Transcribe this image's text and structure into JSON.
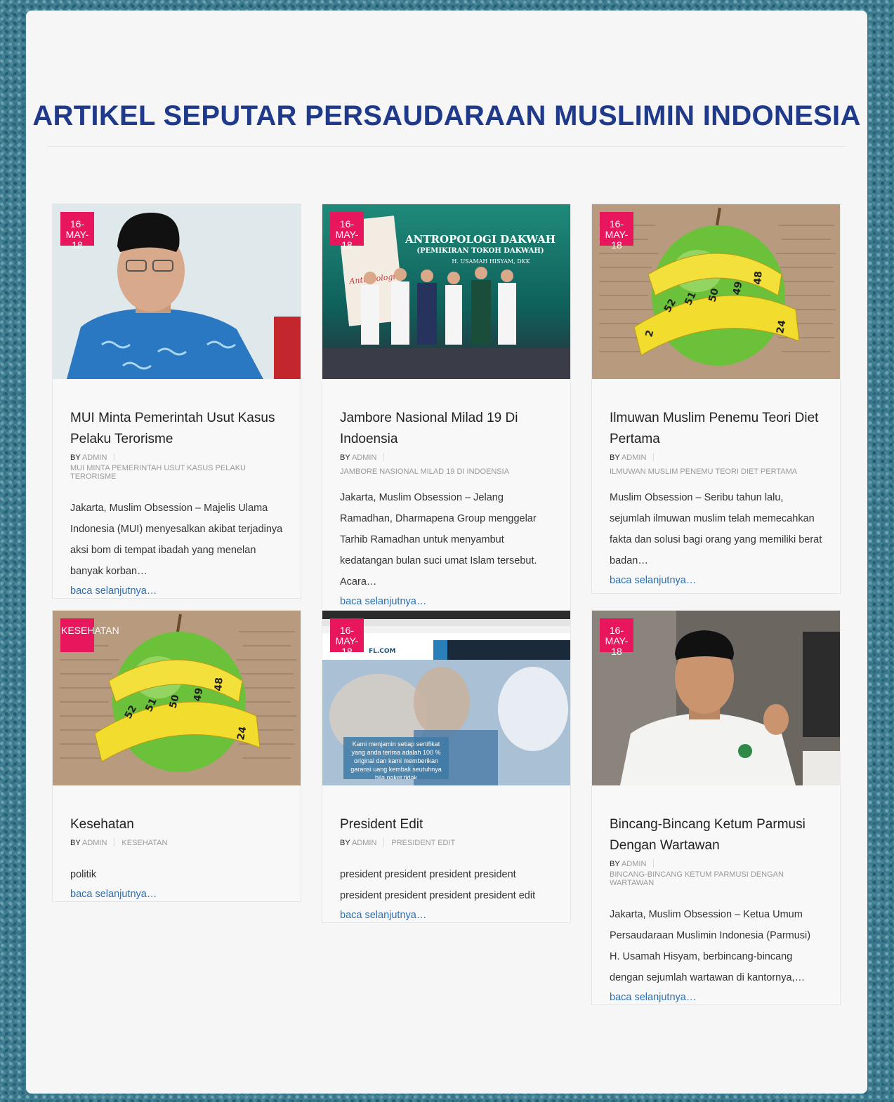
{
  "page": {
    "title": "ARTIKEL SEPUTAR PERSAUDARAAN MUSLIMIN INDONESIA"
  },
  "cards": [
    {
      "badge": "16-\nMAY-18",
      "title": "MUI Minta Pemerintah Usut Kasus Pelaku Terorisme",
      "by": "BY",
      "author": "ADMIN",
      "category": "MUI MINTA PEMERINTAH USUT KASUS PELAKU TERORISME",
      "excerpt": "Jakarta, Muslim Obsession – Majelis Ulama Indonesia (MUI) menyesalkan akibat terjadinya aksi bom di tempat ibadah yang menelan banyak korban…",
      "more": "baca selanjutnya…"
    },
    {
      "badge": "16-\nMAY-18",
      "title": "Jambore Nasional Milad 19 Di Indoensia",
      "by": "BY",
      "author": "ADMIN",
      "category": "JAMBORE NASIONAL MILAD 19 DI INDOENSIA",
      "excerpt": "Jakarta, Muslim Obsession – Jelang Ramadhan, Dharmapena Group menggelar Tarhib Ramadhan untuk menyambut kedatangan bulan suci umat Islam tersebut. Acara…",
      "more": "baca selanjutnya…",
      "image_text": {
        "line1": "ANTROPOLOGI DAKWAH",
        "line2": "(PEMIKIRAN TOKOH DAKWAH)",
        "line3": "H. USAMAH HISYAM, DKK"
      }
    },
    {
      "badge": "16-\nMAY-18",
      "title": "Ilmuwan Muslim Penemu Teori Diet Pertama",
      "by": "BY",
      "author": "ADMIN",
      "category": "ILMUWAN MUSLIM PENEMU TEORI DIET PERTAMA",
      "excerpt": "Muslim Obsession – Seribu tahun lalu, sejumlah ilmuwan muslim telah memecahkan fakta dan solusi bagi orang yang memiliki berat badan…",
      "more": "baca selanjutnya…"
    },
    {
      "badge": "KESEHATAN",
      "title": "Kesehatan",
      "by": "BY",
      "author": "ADMIN",
      "category": "KESEHATAN",
      "excerpt": "politik",
      "more": "baca selanjutnya…"
    },
    {
      "badge": "16-\nMAY-18",
      "title": "President Edit",
      "by": "BY",
      "author": "ADMIN",
      "category": "PRESIDENT EDIT",
      "excerpt": "president president president president president president president president edit",
      "more": "baca selanjutnya…",
      "image_text": {
        "site": "FL.COM",
        "caption": "Kami menjamin setiap sertifikat yang anda terima adalah 100 % original dan kami memberikan garansi uang kembali seutuhnya bila paket tidak"
      }
    },
    {
      "badge": "16-\nMAY-18",
      "title": "Bincang-Bincang Ketum Parmusi Dengan Wartawan",
      "by": "BY",
      "author": "ADMIN",
      "category": "BINCANG-BINCANG KETUM PARMUSI DENGAN WARTAWAN",
      "excerpt": "Jakarta, Muslim Obsession – Ketua Umum Persaudaraan Muslimin Indonesia (Parmusi) H. Usamah Hisyam, berbincang-bincang dengan sejumlah wartawan di kantornya,…",
      "more": "baca selanjutnya…"
    }
  ],
  "colors": {
    "title": "#1f3a8a",
    "badge": "#e8175d",
    "link": "#2a6fb5"
  }
}
